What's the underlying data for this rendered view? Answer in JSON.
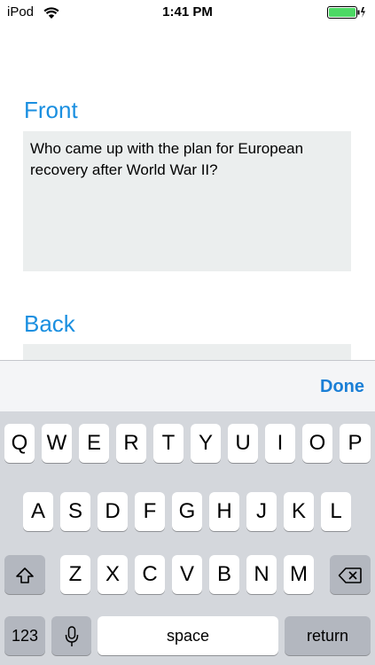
{
  "status_bar": {
    "carrier": "iPod",
    "time": "1:41 PM"
  },
  "card": {
    "front_label": "Front",
    "front_text": "Who came up with the plan for European recovery after World War II?",
    "back_label": "Back",
    "back_text": ""
  },
  "keyboard": {
    "done_label": "Done",
    "row1": [
      "Q",
      "W",
      "E",
      "R",
      "T",
      "Y",
      "U",
      "I",
      "O",
      "P"
    ],
    "row2": [
      "A",
      "S",
      "D",
      "F",
      "G",
      "H",
      "J",
      "K",
      "L"
    ],
    "row3": [
      "Z",
      "X",
      "C",
      "V",
      "B",
      "N",
      "M"
    ],
    "numbers_label": "123",
    "space_label": "space",
    "return_label": "return",
    "shift_icon": "shift-icon",
    "delete_icon": "delete-icon",
    "mic_icon": "microphone-icon",
    "accent_color": "#1a8fe0"
  }
}
